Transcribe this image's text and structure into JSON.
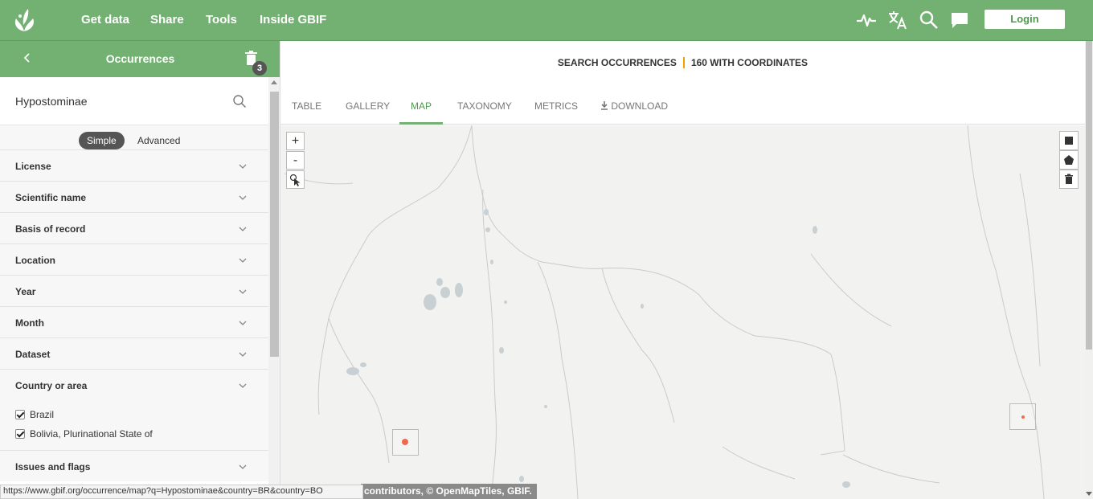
{
  "topnav": {
    "items": [
      "Get data",
      "Share",
      "Tools",
      "Inside GBIF"
    ],
    "login_label": "Login",
    "icons": [
      "gbif-logo-icon",
      "activity-pulse-icon",
      "translate-icon",
      "search-icon",
      "feedback-chat-icon"
    ],
    "colors": {
      "brand": "#72b172",
      "accent": "#4e9a4e"
    }
  },
  "sidebar": {
    "title": "Occurrences",
    "trash_count": "3",
    "search_value": "Hypostominae",
    "mode_simple": "Simple",
    "mode_advanced": "Advanced",
    "filters": [
      "License",
      "Scientific name",
      "Basis of record",
      "Location",
      "Year",
      "Month",
      "Dataset"
    ],
    "country_label": "Country or area",
    "countries": [
      "Brazil",
      "Bolivia, Plurinational State of"
    ],
    "issues_label": "Issues and flags"
  },
  "main": {
    "stats_left": "SEARCH OCCURRENCES",
    "stats_right": "160 WITH COORDINATES",
    "tabs": [
      "TABLE",
      "GALLERY",
      "MAP",
      "TAXONOMY",
      "METRICS",
      "DOWNLOAD"
    ],
    "active_tab": "MAP",
    "zoom_in": "+",
    "zoom_out": "-",
    "attribution": "contributors, © OpenMapTiles, GBIF.",
    "colors": {
      "marker": "#f06a4f",
      "tab_active": "#4e9a4e",
      "stats_separator": "#f0a000"
    }
  },
  "statusbar": {
    "url": "https://www.gbif.org/occurrence/map?q=Hypostominae&country=BR&country=BO"
  }
}
